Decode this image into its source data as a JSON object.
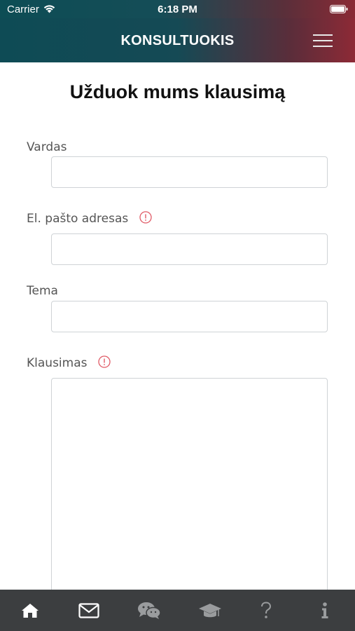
{
  "status_bar": {
    "carrier": "Carrier",
    "time": "6:18 PM"
  },
  "header": {
    "title": "KONSULTUOKIS",
    "menu_icon": "hamburger-menu-icon"
  },
  "page": {
    "title": "Užduok mums klausimą"
  },
  "form": {
    "name_label": "Vardas",
    "email_label": "El. pašto adresas",
    "subject_label": "Tema",
    "question_label": "Klausimas",
    "name_value": "",
    "email_value": "",
    "subject_value": "",
    "question_value": "",
    "required_icon": "exclamation-circle-icon"
  },
  "tab_bar": {
    "items": [
      {
        "icon": "home-icon"
      },
      {
        "icon": "envelope-icon"
      },
      {
        "icon": "chat-icon"
      },
      {
        "icon": "graduation-cap-icon"
      },
      {
        "icon": "question-mark-icon"
      },
      {
        "icon": "info-icon"
      }
    ]
  },
  "colors": {
    "header_start": "#0e4b55",
    "header_end": "#8d2a36",
    "tab_bar": "#3c3e40",
    "warning": "#e05a66"
  }
}
